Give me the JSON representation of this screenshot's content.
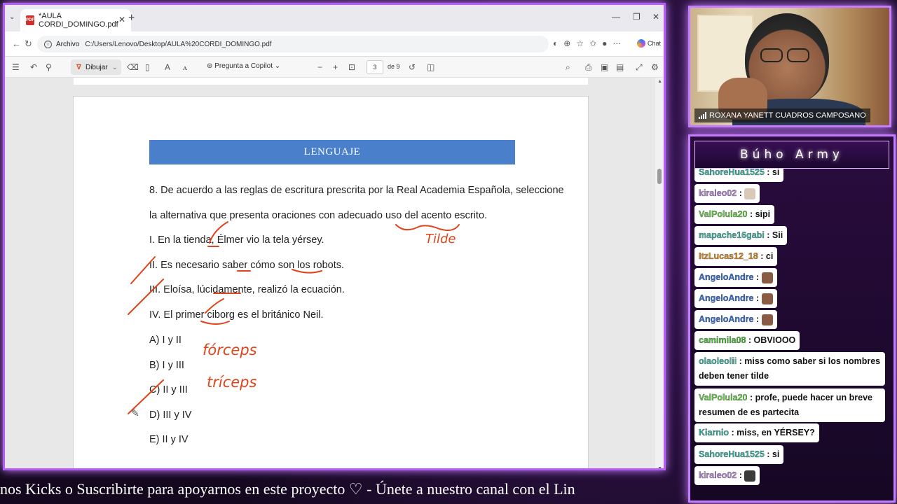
{
  "browser": {
    "tab_title": "*AULA CORDI_DOMINGO.pdf",
    "address_label": "Archivo",
    "url": "C:/Users/Lenovo/Desktop/AULA%20CORDI_DOMINGO.pdf",
    "chat_label": "Chat"
  },
  "pdf_toolbar": {
    "draw_label": "Dibujar",
    "copilot_label": "Pregunta a Copilot",
    "page_current": "3",
    "page_total": "de 9"
  },
  "pdf": {
    "banner": "LENGUAJE",
    "question_line1": "8. De acuerdo a las reglas de escritura prescrita por la Real Academia Española, seleccione",
    "question_line2": "la alternativa que presenta oraciones con adecuado uso del acento escrito.",
    "items": [
      "I. En la tienda, Élmer vio la tela yérsey.",
      "II. Es necesario saber cómo son los robots.",
      "III. Eloísa, lúcidamente, realizó la ecuación.",
      "IV. El primer ciborg es el británico Neil."
    ],
    "options": [
      "A) I y II",
      "B) I y III",
      "C) II y III",
      "D) III y IV",
      "E) II y IV"
    ],
    "handwriting": [
      "Tilde",
      "fórceps",
      "tríceps"
    ]
  },
  "webcam": {
    "name": "ROXANA YANETT CUADROS CAMPOSANO"
  },
  "chat": {
    "title": "Búho Army",
    "messages": [
      {
        "user": "SahoreHua1525",
        "text": "si",
        "color": "#3fb8a8"
      },
      {
        "user": "kiraleo02",
        "text": "",
        "color": "#b98ad9",
        "emote": "hand"
      },
      {
        "user": "ValPolula20",
        "text": "sipi",
        "color": "#6ccf4f"
      },
      {
        "user": "mapache16gabi",
        "text": "Sii",
        "color": "#3fb8a8"
      },
      {
        "user": "ItzLucas12_18",
        "text": "ci",
        "color": "#e08a20"
      },
      {
        "user": "AngeloAndre",
        "text": "",
        "color": "#3a6fd8",
        "emote": "face"
      },
      {
        "user": "AngeloAndre",
        "text": "",
        "color": "#3a6fd8",
        "emote": "face"
      },
      {
        "user": "AngeloAndre",
        "text": "",
        "color": "#3a6fd8",
        "emote": "face"
      },
      {
        "user": "camimila08",
        "text": "OBVIOOO",
        "color": "#4cc13a"
      },
      {
        "user": "olaoleolii",
        "text": "miss como saber si los nombres deben tener tilde",
        "color": "#3fb8a8"
      },
      {
        "user": "ValPolula20",
        "text": "profe, puede hacer un breve resumen de es partecita",
        "color": "#6ccf4f"
      },
      {
        "user": "Kiarnio",
        "text": "miss, en YÉRSEY?",
        "color": "#3fb8a8"
      },
      {
        "user": "SahoreHua1525",
        "text": "si",
        "color": "#3fb8a8"
      },
      {
        "user": "kiraleo02",
        "text": "",
        "color": "#b98ad9",
        "emote": "panda"
      }
    ]
  },
  "ticker": {
    "text": "nos Kicks o Suscribirte para apoyarnos en este proyecto  ♡   -   Únete a nuestro canal con el Lin"
  }
}
